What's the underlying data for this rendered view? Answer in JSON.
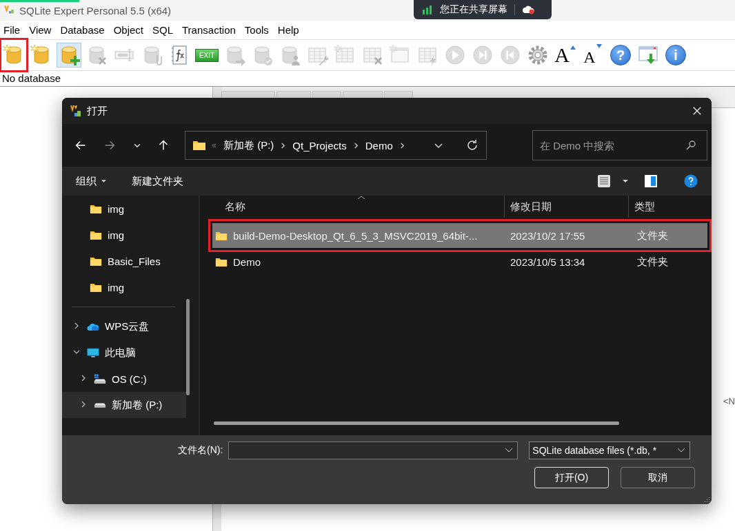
{
  "app": {
    "title": "SQLite Expert Personal 5.5 (x64)"
  },
  "share_banner": {
    "text": "您正在共享屏幕"
  },
  "menu": [
    "File",
    "View",
    "Database",
    "Object",
    "SQL",
    "Transaction",
    "Tools",
    "Help"
  ],
  "toolbar": [
    {
      "kind": "createdb",
      "disabled": false,
      "pressed": false,
      "highlighted": true
    },
    {
      "kind": "opendb",
      "disabled": false,
      "pressed": false,
      "highlighted": false
    },
    {
      "kind": "attachdb",
      "disabled": false,
      "pressed": true,
      "highlighted": false
    },
    {
      "kind": "detachdb",
      "disabled": true,
      "pressed": false,
      "highlighted": false
    },
    {
      "kind": "field",
      "disabled": true,
      "pressed": false,
      "highlighted": false
    },
    {
      "kind": "clipdb",
      "disabled": true,
      "pressed": false,
      "highlighted": false
    },
    {
      "kind": "fx",
      "disabled": false,
      "pressed": false,
      "highlighted": false
    },
    {
      "kind": "exit",
      "label": "EXIT",
      "disabled": false,
      "pressed": false,
      "highlighted": false
    },
    {
      "kind": "exportdb",
      "disabled": true,
      "pressed": false,
      "highlighted": false
    },
    {
      "kind": "checkdb",
      "disabled": true,
      "pressed": false,
      "highlighted": false
    },
    {
      "kind": "userdb",
      "disabled": true,
      "pressed": false,
      "highlighted": false
    },
    {
      "kind": "tabletool",
      "disabled": true,
      "pressed": false,
      "highlighted": false
    },
    {
      "kind": "newtable",
      "disabled": true,
      "pressed": false,
      "highlighted": false
    },
    {
      "kind": "droptable",
      "disabled": true,
      "pressed": false,
      "highlighted": false
    },
    {
      "kind": "newwindow",
      "disabled": true,
      "pressed": false,
      "highlighted": false
    },
    {
      "kind": "tablebolt",
      "disabled": true,
      "pressed": false,
      "highlighted": false
    },
    {
      "kind": "play",
      "disabled": true,
      "pressed": false,
      "highlighted": false
    },
    {
      "kind": "next",
      "disabled": true,
      "pressed": false,
      "highlighted": false
    },
    {
      "kind": "prev",
      "disabled": true,
      "pressed": false,
      "highlighted": false
    },
    {
      "kind": "gear",
      "disabled": false,
      "pressed": false,
      "highlighted": false
    },
    {
      "kind": "font-up",
      "label": "A",
      "disabled": false,
      "pressed": false,
      "highlighted": false
    },
    {
      "kind": "font-down",
      "label": "A",
      "disabled": false,
      "pressed": false,
      "highlighted": false
    },
    {
      "kind": "help",
      "label": "?",
      "disabled": false,
      "pressed": false,
      "highlighted": false
    },
    {
      "kind": "download",
      "disabled": false,
      "pressed": false,
      "highlighted": false
    },
    {
      "kind": "info",
      "label": "i",
      "disabled": false,
      "pressed": false,
      "highlighted": false
    }
  ],
  "status": "No database",
  "background_panel": {
    "cut_text": "<N"
  },
  "dialog": {
    "title": "打开",
    "nav": [
      {
        "kind": "back",
        "disabled": false
      },
      {
        "kind": "forward",
        "disabled": true
      },
      {
        "kind": "recent",
        "disabled": false
      },
      {
        "kind": "up",
        "disabled": false
      }
    ],
    "path": [
      "新加卷 (P:)",
      "Qt_Projects",
      "Demo"
    ],
    "search": {
      "placeholder": "在 Demo 中搜索"
    },
    "commands": {
      "organize": "组织",
      "new_folder": "新建文件夹"
    },
    "sidebar": [
      {
        "label": "img",
        "kind": "folder",
        "selected": false
      },
      {
        "label": "img",
        "kind": "folder",
        "selected": false
      },
      {
        "label": "Basic_Files",
        "kind": "folder",
        "selected": false
      },
      {
        "label": "img",
        "kind": "folder",
        "selected": false
      },
      {
        "kind": "separator"
      },
      {
        "label": "WPS云盘",
        "kind": "cloud",
        "expanded": false,
        "selected": false
      },
      {
        "label": "此电脑",
        "kind": "pc",
        "expanded": true,
        "selected": false,
        "children": [
          {
            "label": "OS (C:)",
            "kind": "systemdrive",
            "expanded": false,
            "selected": false
          },
          {
            "label": "新加卷 (P:)",
            "kind": "drive",
            "expanded": false,
            "selected": true
          }
        ]
      }
    ],
    "columns": [
      "名称",
      "修改日期",
      "类型"
    ],
    "files": [
      {
        "name": "build-Demo-Desktop_Qt_6_5_3_MSVC2019_64bit-...",
        "date": "2023/10/2 17:55",
        "type": "文件夹",
        "selected": true,
        "highlighted": true
      },
      {
        "name": "Demo",
        "date": "2023/10/5 13:34",
        "type": "文件夹",
        "selected": false,
        "highlighted": false
      }
    ],
    "file_name": {
      "label": "文件名(N):"
    },
    "file_type": "SQLite database files (*.db, *",
    "buttons": [
      {
        "label": "打开(O)",
        "default": true
      },
      {
        "label": "取消",
        "default": false
      }
    ]
  }
}
